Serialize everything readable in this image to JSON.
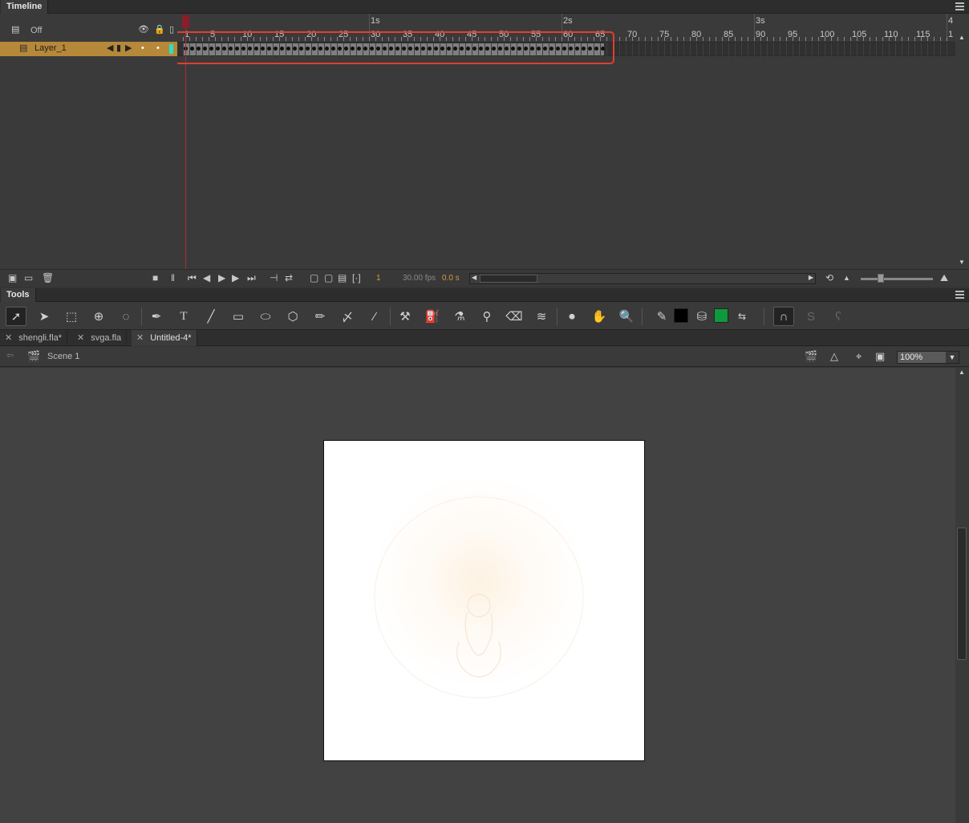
{
  "timeline": {
    "title": "Timeline",
    "layer_header": {
      "outline_label": "Off"
    },
    "layer": {
      "name": "Layer_1"
    },
    "ruler": {
      "seconds": [
        "1s",
        "2s",
        "3s",
        "4"
      ],
      "frame_numbers": [
        "1",
        "5",
        "10",
        "15",
        "20",
        "25",
        "30",
        "35",
        "40",
        "45",
        "50",
        "55",
        "60",
        "65",
        "70",
        "75",
        "80",
        "85",
        "90",
        "95",
        "100",
        "105",
        "110",
        "115",
        "1"
      ]
    },
    "total_keyframes": 66,
    "status": {
      "current_frame": "1",
      "fps": "30.00 fps",
      "elapsed": "0.0 s"
    }
  },
  "tools_panel": {
    "title": "Tools",
    "stroke_color": "#000000",
    "fill_color": "#0e9a3c"
  },
  "doc_tabs": [
    {
      "label": "shengli.fla*",
      "active": false
    },
    {
      "label": "svga.fla",
      "active": false
    },
    {
      "label": "Untitled-4*",
      "active": true
    }
  ],
  "scene_bar": {
    "scene": "Scene 1",
    "zoom": "100%"
  },
  "colors": {
    "accent_layer": "#b6883a",
    "playhead": "#b02b35",
    "highlight": "#e0402f"
  }
}
